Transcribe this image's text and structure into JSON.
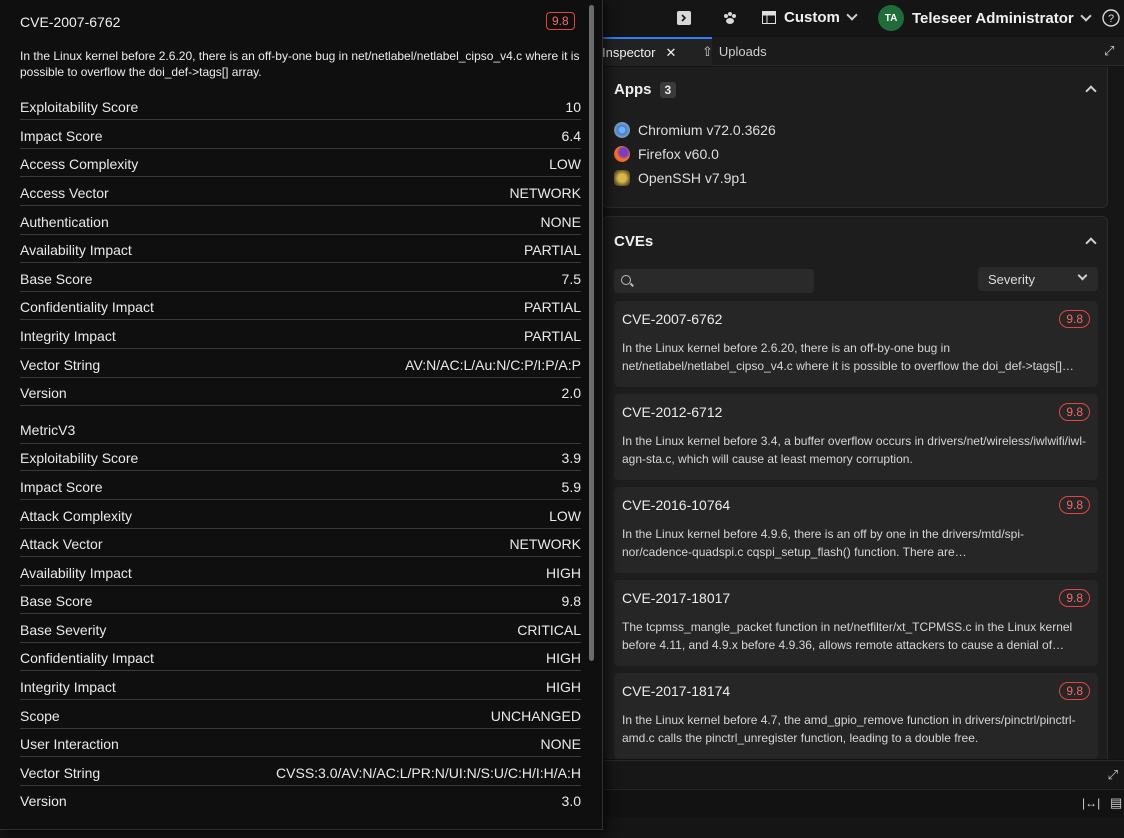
{
  "topbar": {
    "layout_label": "Custom",
    "user_initials": "TA",
    "user_name": "Teleseer Administrator"
  },
  "tabs": [
    {
      "label": "Inspector",
      "active": true
    },
    {
      "label": "Uploads",
      "active": false
    }
  ],
  "apps": {
    "title": "Apps",
    "count": "3",
    "items": [
      {
        "label": "Chromium v72.0.3626",
        "icon": "chromium-icon"
      },
      {
        "label": "Firefox v60.0",
        "icon": "firefox-icon"
      },
      {
        "label": "OpenSSH v7.9p1",
        "icon": "openssh-icon"
      }
    ]
  },
  "cves": {
    "title": "CVEs",
    "search_placeholder": "",
    "sort_label": "Severity",
    "items": [
      {
        "id": "CVE-2007-6762",
        "score": "9.8",
        "desc": "In the Linux kernel before 2.6.20, there is an off-by-one bug in net/netlabel/netlabel_cipso_v4.c where it is possible to overflow the doi_def->tags[]…"
      },
      {
        "id": "CVE-2012-6712",
        "score": "9.8",
        "desc": "In the Linux kernel before 3.4, a buffer overflow occurs in drivers/net/wireless/iwlwifi/iwl-agn-sta.c, which will cause at least memory corruption."
      },
      {
        "id": "CVE-2016-10764",
        "score": "9.8",
        "desc": "In the Linux kernel before 4.9.6, there is an off by one in the drivers/mtd/spi-nor/cadence-quadspi.c cqspi_setup_flash() function. There are…"
      },
      {
        "id": "CVE-2017-18017",
        "score": "9.8",
        "desc": "The tcpmss_mangle_packet function in net/netfilter/xt_TCPMSS.c in the Linux kernel before 4.11, and 4.9.x before 4.9.36, allows remote attackers to cause a denial of…"
      },
      {
        "id": "CVE-2017-18174",
        "score": "9.8",
        "desc": "In the Linux kernel before 4.7, the amd_gpio_remove function in drivers/pinctrl/pinctrl-amd.c calls the pinctrl_unregister function, leading to a double free."
      }
    ]
  },
  "tooltip": {
    "title": "CVE-2007-6762",
    "score": "9.8",
    "description": "In the Linux kernel before 2.6.20, there is an off-by-one bug in net/netlabel/netlabel_cipso_v4.c where it is possible to overflow the doi_def->tags[] array.",
    "metric_v2": [
      {
        "k": "Exploitability Score",
        "v": "10"
      },
      {
        "k": "Impact Score",
        "v": "6.4"
      },
      {
        "k": "Access Complexity",
        "v": "LOW"
      },
      {
        "k": "Access Vector",
        "v": "NETWORK"
      },
      {
        "k": "Authentication",
        "v": "NONE"
      },
      {
        "k": "Availability Impact",
        "v": "PARTIAL"
      },
      {
        "k": "Base Score",
        "v": "7.5"
      },
      {
        "k": "Confidentiality Impact",
        "v": "PARTIAL"
      },
      {
        "k": "Integrity Impact",
        "v": "PARTIAL"
      },
      {
        "k": "Vector String",
        "v": "AV:N/AC:L/Au:N/C:P/I:P/A:P"
      },
      {
        "k": "Version",
        "v": "2.0"
      }
    ],
    "section_v3": "MetricV3",
    "metric_v3": [
      {
        "k": "Exploitability Score",
        "v": "3.9"
      },
      {
        "k": "Impact Score",
        "v": "5.9"
      },
      {
        "k": "Attack Complexity",
        "v": "LOW"
      },
      {
        "k": "Attack Vector",
        "v": "NETWORK"
      },
      {
        "k": "Availability Impact",
        "v": "HIGH"
      },
      {
        "k": "Base Score",
        "v": "9.8"
      },
      {
        "k": "Base Severity",
        "v": "CRITICAL"
      },
      {
        "k": "Confidentiality Impact",
        "v": "HIGH"
      },
      {
        "k": "Integrity Impact",
        "v": "HIGH"
      },
      {
        "k": "Scope",
        "v": "UNCHANGED"
      },
      {
        "k": "User Interaction",
        "v": "NONE"
      },
      {
        "k": "Vector String",
        "v": "CVSS:3.0/AV:N/AC:L/PR:N/UI:N/S:U/C:H/I:H/A:H"
      },
      {
        "k": "Version",
        "v": "3.0"
      }
    ]
  },
  "colors": {
    "accent": "#2d7ff9",
    "critical": "#e04545"
  }
}
